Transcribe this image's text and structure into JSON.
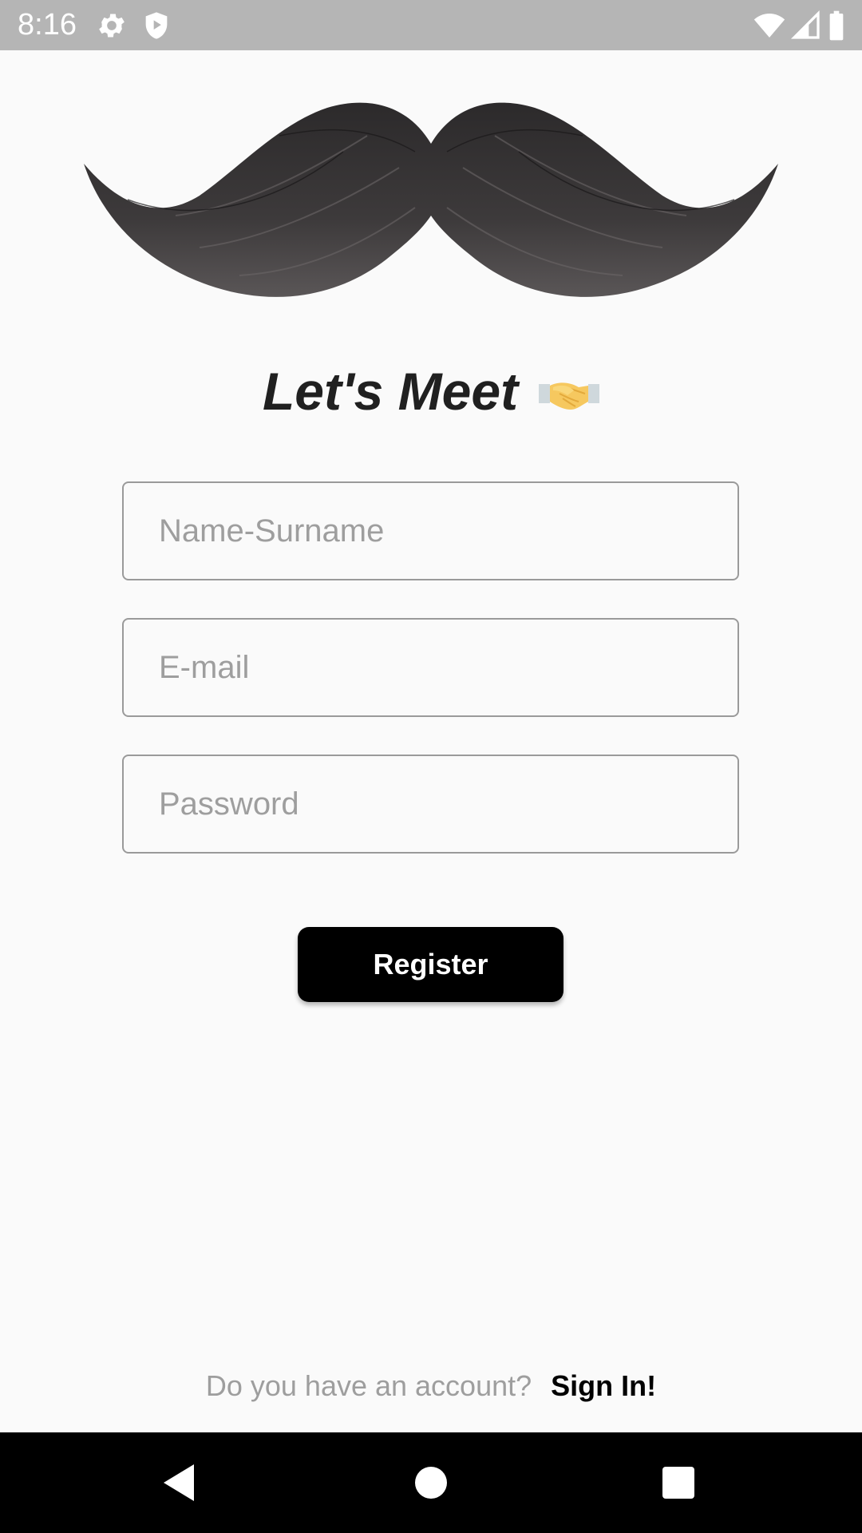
{
  "status_bar": {
    "time": "8:16",
    "icons": [
      "gear-icon",
      "shield-icon",
      "wifi-icon",
      "signal-icon",
      "battery-icon"
    ]
  },
  "header": {
    "logo": "mustache-image",
    "title": "Let's Meet",
    "title_icon": "handshake-icon"
  },
  "form": {
    "name_placeholder": "Name-Surname",
    "email_placeholder": "E-mail",
    "password_placeholder": "Password",
    "register_label": "Register"
  },
  "footer": {
    "question": "Do you have an account?",
    "signin_label": "Sign In!"
  },
  "nav_bar": {
    "buttons": [
      "back-icon",
      "home-icon",
      "recents-icon"
    ]
  },
  "colors": {
    "background": "#fafafa",
    "status_bar": "#b5b5b5",
    "button": "#000000",
    "placeholder": "#9e9e9e",
    "field_border": "#9a9a9a"
  }
}
